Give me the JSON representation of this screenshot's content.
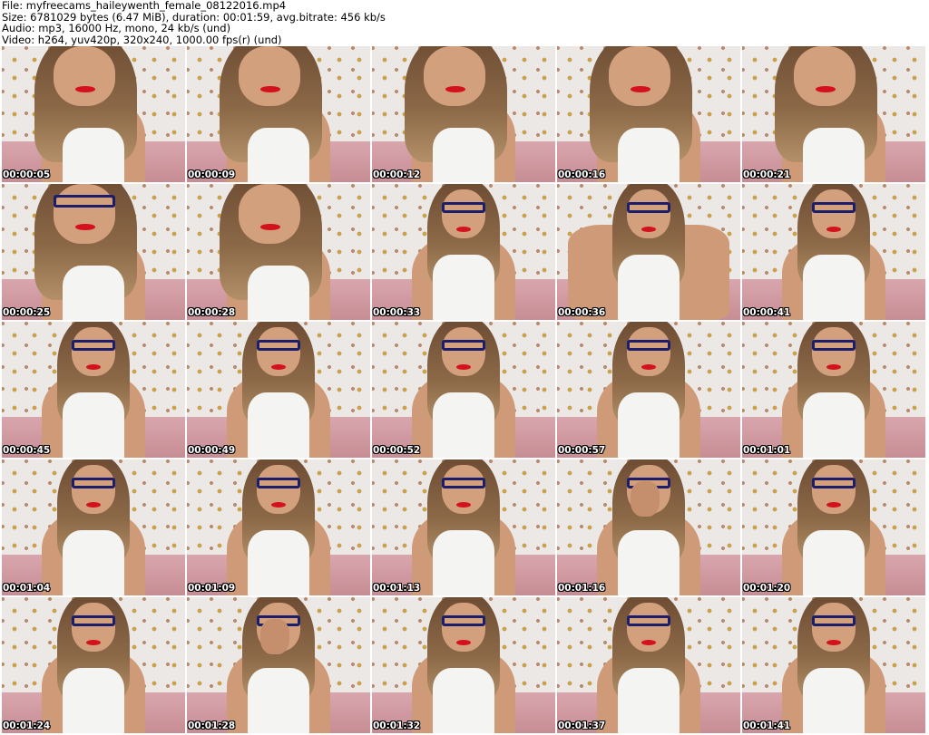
{
  "header": {
    "file": "File: myfreecams_haileywenth_female_08122016.mp4",
    "size": "Size: 6781029 bytes (6.47 MiB), duration: 00:01:59, avg.bitrate: 456 kb/s",
    "audio": "Audio: mp3, 16000 Hz, mono, 24 kb/s (und)",
    "video": "Video: h264, yuv420p, 320x240, 1000.00 fps(r) (und)"
  },
  "thumbnails": [
    {
      "timestamp": "00:00:05"
    },
    {
      "timestamp": "00:00:09"
    },
    {
      "timestamp": "00:00:12"
    },
    {
      "timestamp": "00:00:16"
    },
    {
      "timestamp": "00:00:21"
    },
    {
      "timestamp": "00:00:25"
    },
    {
      "timestamp": "00:00:28"
    },
    {
      "timestamp": "00:00:33"
    },
    {
      "timestamp": "00:00:36"
    },
    {
      "timestamp": "00:00:41"
    },
    {
      "timestamp": "00:00:45"
    },
    {
      "timestamp": "00:00:49"
    },
    {
      "timestamp": "00:00:52"
    },
    {
      "timestamp": "00:00:57"
    },
    {
      "timestamp": "00:01:01"
    },
    {
      "timestamp": "00:01:04"
    },
    {
      "timestamp": "00:01:09"
    },
    {
      "timestamp": "00:01:13"
    },
    {
      "timestamp": "00:01:16"
    },
    {
      "timestamp": "00:01:20"
    },
    {
      "timestamp": "00:01:24"
    },
    {
      "timestamp": "00:01:28"
    },
    {
      "timestamp": "00:01:32"
    },
    {
      "timestamp": "00:01:37"
    },
    {
      "timestamp": "00:01:41"
    }
  ]
}
